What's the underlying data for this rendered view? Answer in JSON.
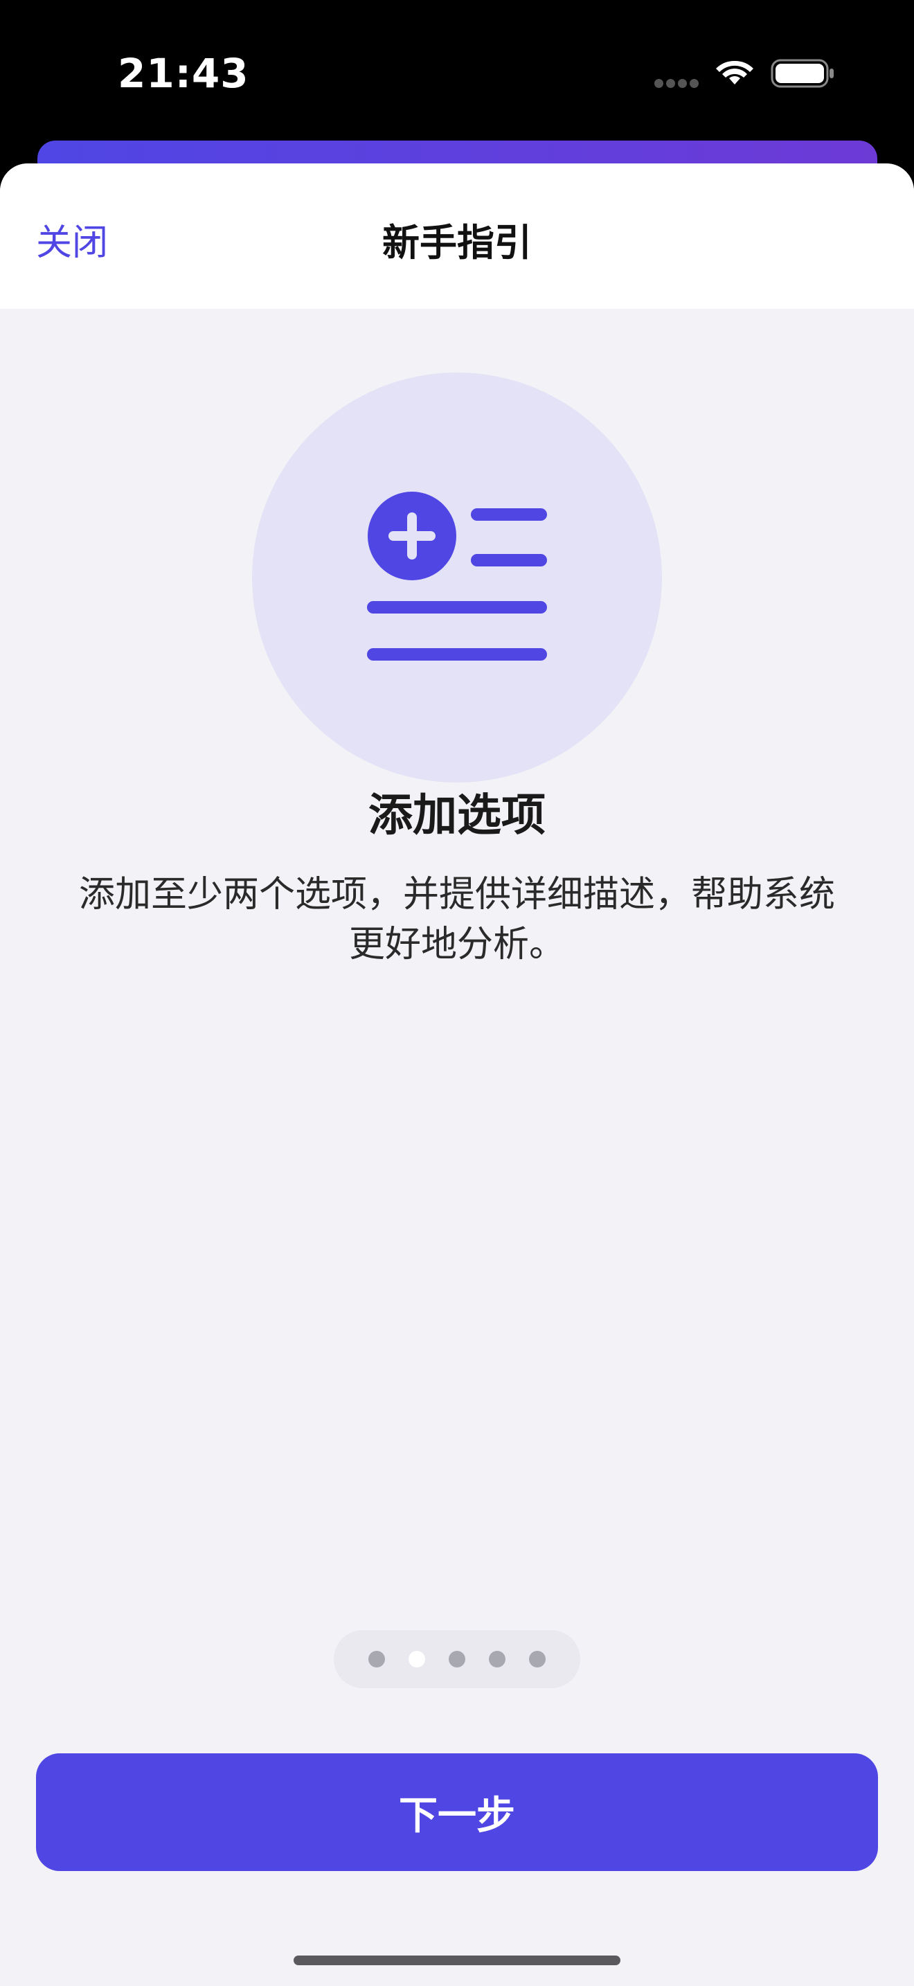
{
  "status_bar": {
    "time": "21:43",
    "icons": [
      "signal-dots-icon",
      "wifi-icon",
      "battery-icon"
    ]
  },
  "nav": {
    "close_label": "关闭",
    "title": "新手指引"
  },
  "step": {
    "icon": "add-list-icon",
    "title": "添加选项",
    "description": "添加至少两个选项，并提供详细描述，帮助系统更好地分析。"
  },
  "pagination": {
    "total": 5,
    "current": 2
  },
  "footer": {
    "next_label": "下一步"
  },
  "colors": {
    "accent": "#5046e4",
    "hero_circle": "#e3e2f6",
    "sheet_background": "#f2f2f7",
    "nav_background": "#ffffff"
  }
}
